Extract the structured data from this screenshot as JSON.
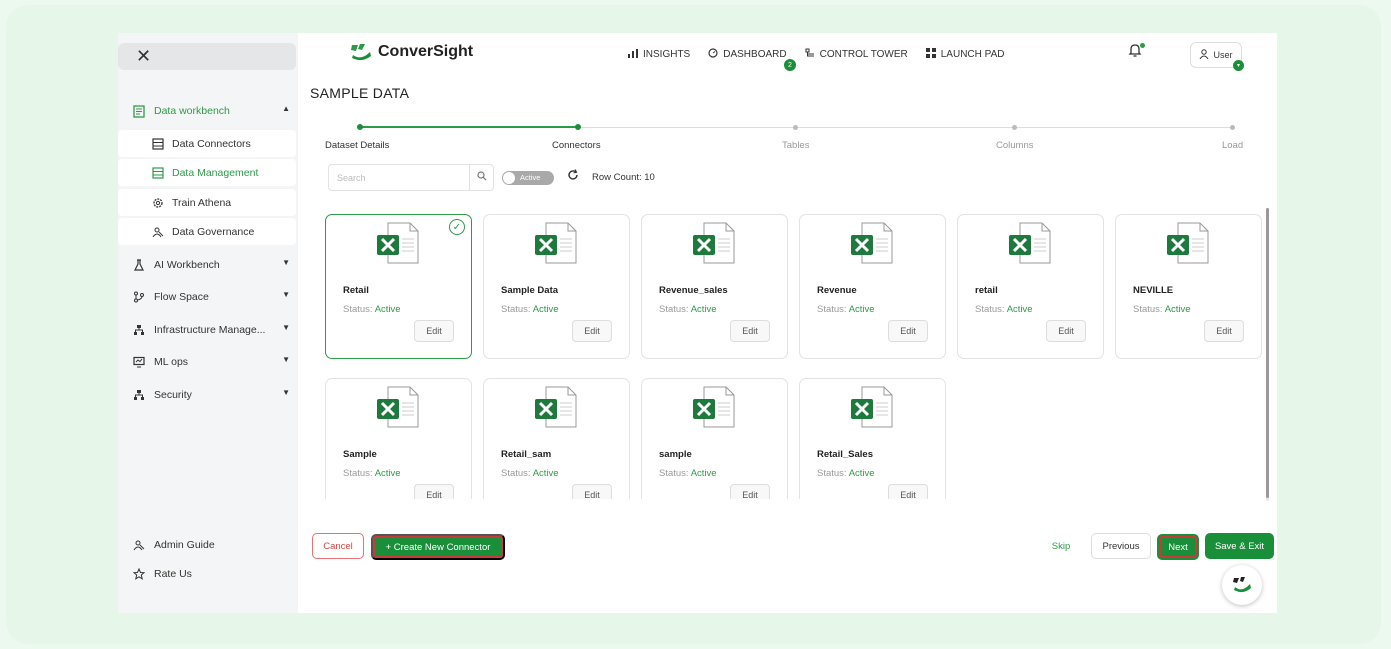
{
  "sidebar": {
    "close_label": "✕",
    "workbench": "Data workbench",
    "sub_items": [
      {
        "label": "Data Connectors",
        "icon": "table-icon"
      },
      {
        "label": "Data Management",
        "icon": "table-icon"
      },
      {
        "label": "Train Athena",
        "icon": "gear-icon"
      },
      {
        "label": "Data Governance",
        "icon": "people-icon"
      }
    ],
    "items": [
      {
        "label": "AI Workbench",
        "icon": "flask-icon"
      },
      {
        "label": "Flow Space",
        "icon": "flow-icon"
      },
      {
        "label": "Infrastructure Manage...",
        "icon": "hierarchy-icon"
      },
      {
        "label": "ML ops",
        "icon": "monitor-icon"
      },
      {
        "label": "Security",
        "icon": "hierarchy-icon"
      }
    ],
    "admin_guide": "Admin Guide",
    "rate_us": "Rate Us"
  },
  "header": {
    "logo_text": "ConverSight",
    "nav": [
      {
        "label": "INSIGHTS",
        "icon": "bar-chart-icon"
      },
      {
        "label": "DASHBOARD",
        "icon": "gauge-icon"
      },
      {
        "label": "CONTROL TOWER",
        "icon": "tower-icon"
      },
      {
        "label": "LAUNCH PAD",
        "icon": "grid-icon"
      }
    ],
    "dashboard_badge": "2",
    "user_label": "User",
    "user_badge": "▾"
  },
  "page_title": "SAMPLE DATA",
  "stepper": [
    {
      "label": "Dataset Details",
      "done": true
    },
    {
      "label": "Connectors",
      "done": true
    },
    {
      "label": "Tables",
      "done": false
    },
    {
      "label": "Columns",
      "done": false
    },
    {
      "label": "Load",
      "done": false
    }
  ],
  "toolbar": {
    "search_placeholder": "Search",
    "toggle_label": "Active",
    "row_count": "Row Count: 10"
  },
  "status_prefix": "Status:",
  "status_value": "Active",
  "edit_label": "Edit",
  "connectors": [
    {
      "name": "Retail",
      "selected": true
    },
    {
      "name": "Sample Data"
    },
    {
      "name": "Revenue_sales"
    },
    {
      "name": "Revenue"
    },
    {
      "name": "retail"
    },
    {
      "name": "NEVILLE"
    },
    {
      "name": "Sample"
    },
    {
      "name": "Retail_sam"
    },
    {
      "name": "sample"
    },
    {
      "name": "Retail_Sales"
    }
  ],
  "footer": {
    "cancel": "Cancel",
    "create": "+ Create New Connector",
    "skip": "Skip",
    "previous": "Previous",
    "next": "Next",
    "save_exit": "Save & Exit"
  },
  "colors": {
    "brand_green": "#1a8f3a",
    "accent_green": "#2e9a48",
    "cancel_red": "#d84343"
  }
}
